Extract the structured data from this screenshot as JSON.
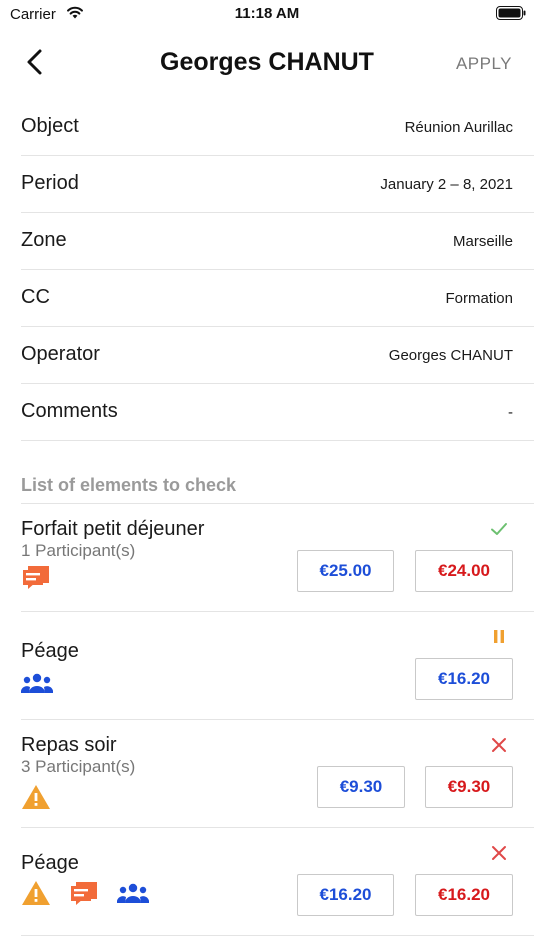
{
  "status_bar": {
    "carrier": "Carrier",
    "time": "11:18 AM"
  },
  "nav": {
    "title": "Georges CHANUT",
    "apply_label": "APPLY"
  },
  "details": [
    {
      "label": "Object",
      "value": "Réunion Aurillac"
    },
    {
      "label": "Period",
      "value": "January 2 – 8, 2021"
    },
    {
      "label": "Zone",
      "value": "Marseille"
    },
    {
      "label": "CC",
      "value": "Formation"
    },
    {
      "label": "Operator",
      "value": "Georges CHANUT"
    },
    {
      "label": "Comments",
      "value": "-"
    }
  ],
  "section_title": "List of elements to check",
  "items": [
    {
      "name": "Forfait petit déjeuner",
      "participants": "1 Participant(s)",
      "status": "check-icon",
      "icons": [
        "comment-icon"
      ],
      "amount_original": "€25.00",
      "amount_checked": "€24.00"
    },
    {
      "name": "Péage",
      "participants": "",
      "status": "pause-icon",
      "icons": [
        "group-icon"
      ],
      "amount_original": "",
      "amount_checked": "€16.20"
    },
    {
      "name": "Repas soir",
      "participants": "3 Participant(s)",
      "status": "cross-icon",
      "icons": [
        "warning-icon"
      ],
      "amount_original": "€9.30",
      "amount_checked": "€9.30"
    },
    {
      "name": "Péage",
      "participants": "",
      "status": "cross-icon",
      "icons": [
        "warning-icon",
        "comment-icon",
        "group-icon"
      ],
      "amount_original": "€16.20",
      "amount_checked": "€16.20"
    }
  ],
  "colors": {
    "blue": "#1d4ed8",
    "red": "#d7191c",
    "orange": "#f26b3a",
    "amber": "#f0a030",
    "green": "#6cc070"
  }
}
